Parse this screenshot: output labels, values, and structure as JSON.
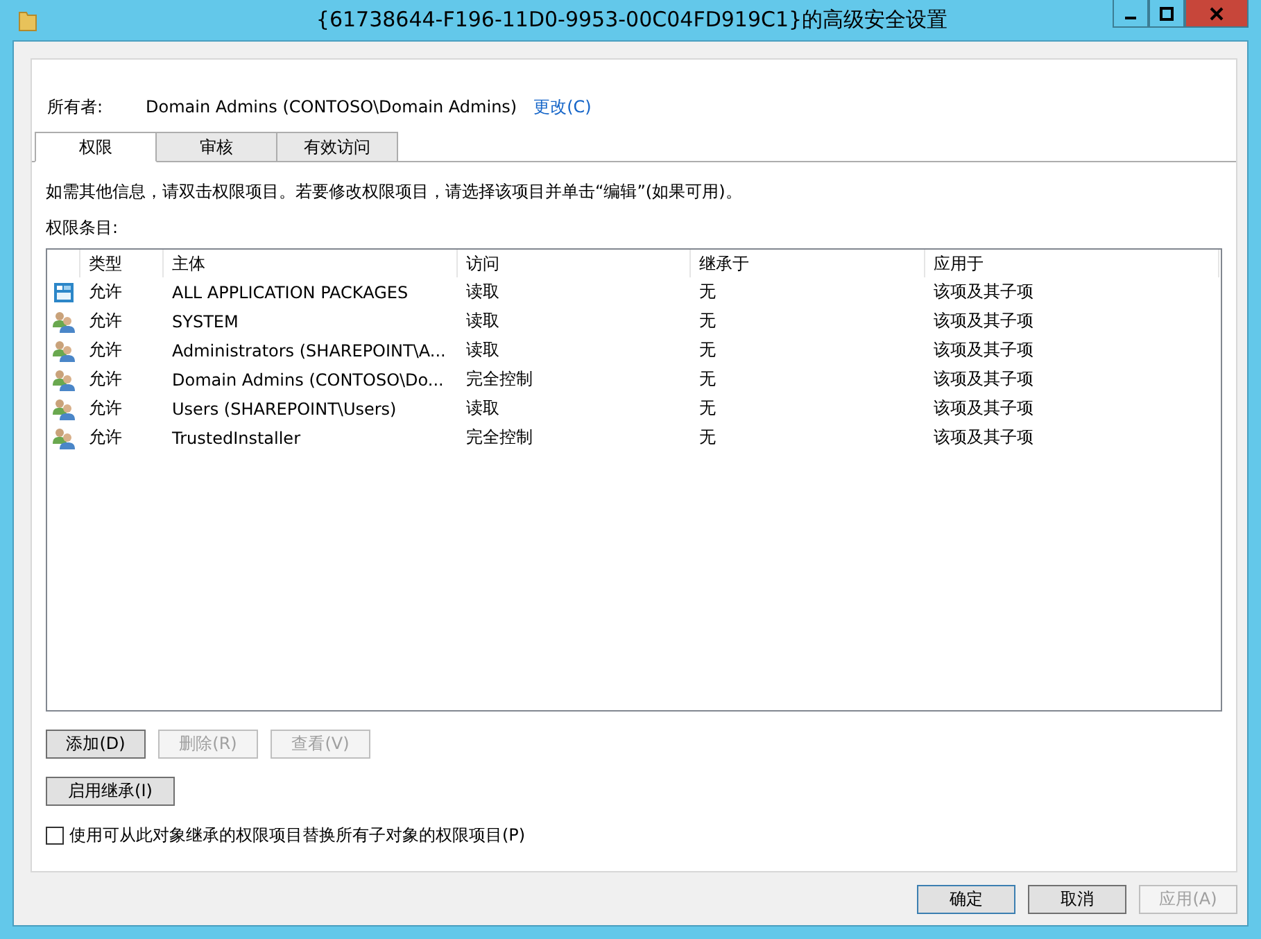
{
  "window": {
    "title": "{61738644-F196-11D0-9953-00C04FD919C1}的高级安全设置"
  },
  "owner": {
    "label": "所有者:",
    "value": "Domain Admins (CONTOSO\\Domain Admins)",
    "change_link": "更改(C)"
  },
  "tabs": [
    {
      "label": "权限",
      "selected": true
    },
    {
      "label": "审核",
      "selected": false
    },
    {
      "label": "有效访问",
      "selected": false
    }
  ],
  "info": "如需其他信息，请双击权限项目。若要修改权限项目，请选择该项目并单击“编辑”(如果可用)。",
  "entries_label": "权限条目:",
  "table": {
    "columns": [
      "类型",
      "主体",
      "访问",
      "继承于",
      "应用于"
    ],
    "rows": [
      {
        "kind": "package",
        "type": "允许",
        "principal": "ALL APPLICATION PACKAGES",
        "access": "读取",
        "inherited_from": "无",
        "applies_to": "该项及其子项",
        "selected": false
      },
      {
        "kind": "group",
        "type": "允许",
        "principal": "SYSTEM",
        "access": "读取",
        "inherited_from": "无",
        "applies_to": "该项及其子项",
        "selected": false
      },
      {
        "kind": "group",
        "type": "允许",
        "principal": "Administrators (SHAREPOINT\\A...",
        "access": "读取",
        "inherited_from": "无",
        "applies_to": "该项及其子项",
        "selected": false
      },
      {
        "kind": "group",
        "type": "允许",
        "principal": "Domain Admins (CONTOSO\\Do...",
        "access": "完全控制",
        "inherited_from": "无",
        "applies_to": "该项及其子项",
        "selected": false
      },
      {
        "kind": "group",
        "type": "允许",
        "principal": "Users (SHAREPOINT\\Users)",
        "access": "读取",
        "inherited_from": "无",
        "applies_to": "该项及其子项",
        "selected": false
      },
      {
        "kind": "group",
        "type": "允许",
        "principal": "TrustedInstaller",
        "access": "完全控制",
        "inherited_from": "无",
        "applies_to": "该项及其子项",
        "selected": false
      }
    ]
  },
  "entry_buttons": [
    {
      "label": "添加(D)",
      "disabled": false
    },
    {
      "label": "删除(R)",
      "disabled": true
    },
    {
      "label": "查看(V)",
      "disabled": true
    }
  ],
  "inheritance_button": {
    "label": "启用继承(I)",
    "disabled": false
  },
  "replace_checkbox": {
    "label": "使用可从此对象继承的权限项目替换所有子对象的权限项目(P)",
    "checked": false
  },
  "dialog_buttons": [
    {
      "label": "确定",
      "disabled": false,
      "default": true
    },
    {
      "label": "取消",
      "disabled": false,
      "default": false
    },
    {
      "label": "应用(A)",
      "disabled": true,
      "default": false
    }
  ]
}
